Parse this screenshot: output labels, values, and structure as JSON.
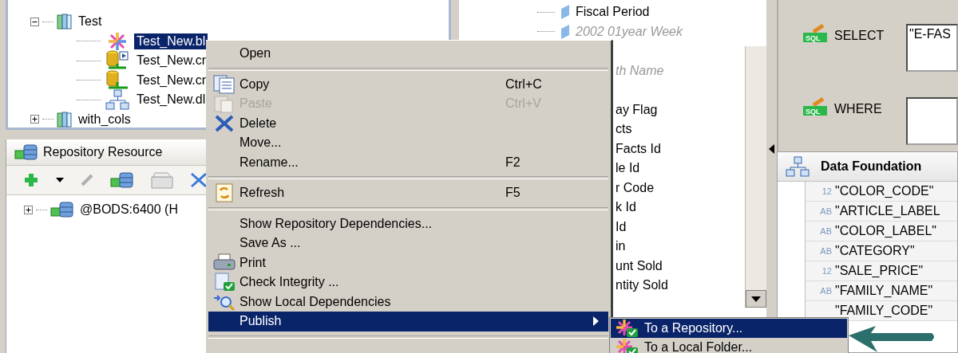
{
  "object_tree": {
    "items": [
      {
        "label": "Test",
        "expanded": true,
        "children": [
          {
            "label": "Test_New.bl",
            "selected": true,
            "kind": "business-layer"
          },
          {
            "label": "Test_New.cr",
            "selected": false,
            "kind": "connection-shortcut"
          },
          {
            "label": "Test_New.cr",
            "selected": false,
            "kind": "connection"
          },
          {
            "label": "Test_New.dl",
            "selected": false,
            "kind": "data-foundation"
          }
        ]
      },
      {
        "label": "with_cols",
        "expanded": false
      }
    ]
  },
  "repository_panel": {
    "title": "Repository Resource",
    "items": [
      {
        "label": "@BODS:6400 (H",
        "expanded": false
      }
    ]
  },
  "middle_list": {
    "items": [
      {
        "label": "Fiscal Period",
        "hidden": false
      },
      {
        "label": "2002 01year Week",
        "hidden": true
      },
      {
        "label": "th Name",
        "hidden": true
      },
      {
        "label": "ay Flag",
        "hidden": false
      },
      {
        "label": "cts",
        "hidden": false
      },
      {
        "label": "Facts Id",
        "hidden": false
      },
      {
        "label": "le Id",
        "hidden": false
      },
      {
        "label": "r Code",
        "hidden": false
      },
      {
        "label": "k Id",
        "hidden": false
      },
      {
        "label": "Id",
        "hidden": false
      },
      {
        "label": "in",
        "hidden": false
      },
      {
        "label": "unt Sold",
        "hidden": false
      },
      {
        "label": "ntity Sold",
        "hidden": false
      }
    ]
  },
  "query": {
    "clauses": [
      {
        "label": "SELECT",
        "badge": "SQL",
        "value": "\"E-FAS"
      },
      {
        "label": "WHERE",
        "badge": "SQL"
      }
    ]
  },
  "data_foundation": {
    "title": "Data Foundation",
    "columns": [
      {
        "type": "12",
        "name": "\"COLOR_CODE\""
      },
      {
        "type": "AB",
        "name": "\"ARTICLE_LABEL"
      },
      {
        "type": "AB",
        "name": "\"COLOR_LABEL\""
      },
      {
        "type": "AB",
        "name": "\"CATEGORY\""
      },
      {
        "type": "12",
        "name": "\"SALE_PRICE\""
      },
      {
        "type": "AB",
        "name": "\"FAMILY_NAME\""
      },
      {
        "name": "\"FAMILY_CODE\""
      }
    ]
  },
  "context_menu": {
    "items": [
      {
        "kind": "item",
        "label": "Open",
        "disabled": false,
        "selected": false
      },
      {
        "kind": "separator"
      },
      {
        "kind": "item",
        "label": "Copy",
        "shortcut": "Ctrl+C",
        "disabled": false,
        "selected": false
      },
      {
        "kind": "item",
        "label": "Paste",
        "shortcut": "Ctrl+V",
        "disabled": true,
        "selected": false
      },
      {
        "kind": "item",
        "label": "Delete",
        "disabled": false,
        "selected": false
      },
      {
        "kind": "item",
        "label": "Move...",
        "disabled": false,
        "selected": false
      },
      {
        "kind": "item",
        "label": "Rename...",
        "shortcut": "F2",
        "disabled": false,
        "selected": false
      },
      {
        "kind": "separator"
      },
      {
        "kind": "item",
        "label": "Refresh",
        "shortcut": "F5",
        "disabled": false,
        "selected": false
      },
      {
        "kind": "separator"
      },
      {
        "kind": "item",
        "label": "Show Repository Dependencies...",
        "disabled": false,
        "selected": false
      },
      {
        "kind": "item",
        "label": "Save As ...",
        "disabled": false,
        "selected": false
      },
      {
        "kind": "item",
        "label": "Print",
        "disabled": false,
        "selected": false
      },
      {
        "kind": "item",
        "label": "Check Integrity ...",
        "disabled": false,
        "selected": false
      },
      {
        "kind": "item",
        "label": "Show Local Dependencies",
        "disabled": false,
        "selected": false
      },
      {
        "kind": "submenu",
        "label": "Publish",
        "disabled": false,
        "selected": true
      },
      {
        "kind": "separator"
      }
    ]
  },
  "submenu": {
    "items": [
      {
        "label": "To a Repository...",
        "selected": true
      },
      {
        "label": "To a Local Folder...",
        "selected": false
      }
    ]
  }
}
